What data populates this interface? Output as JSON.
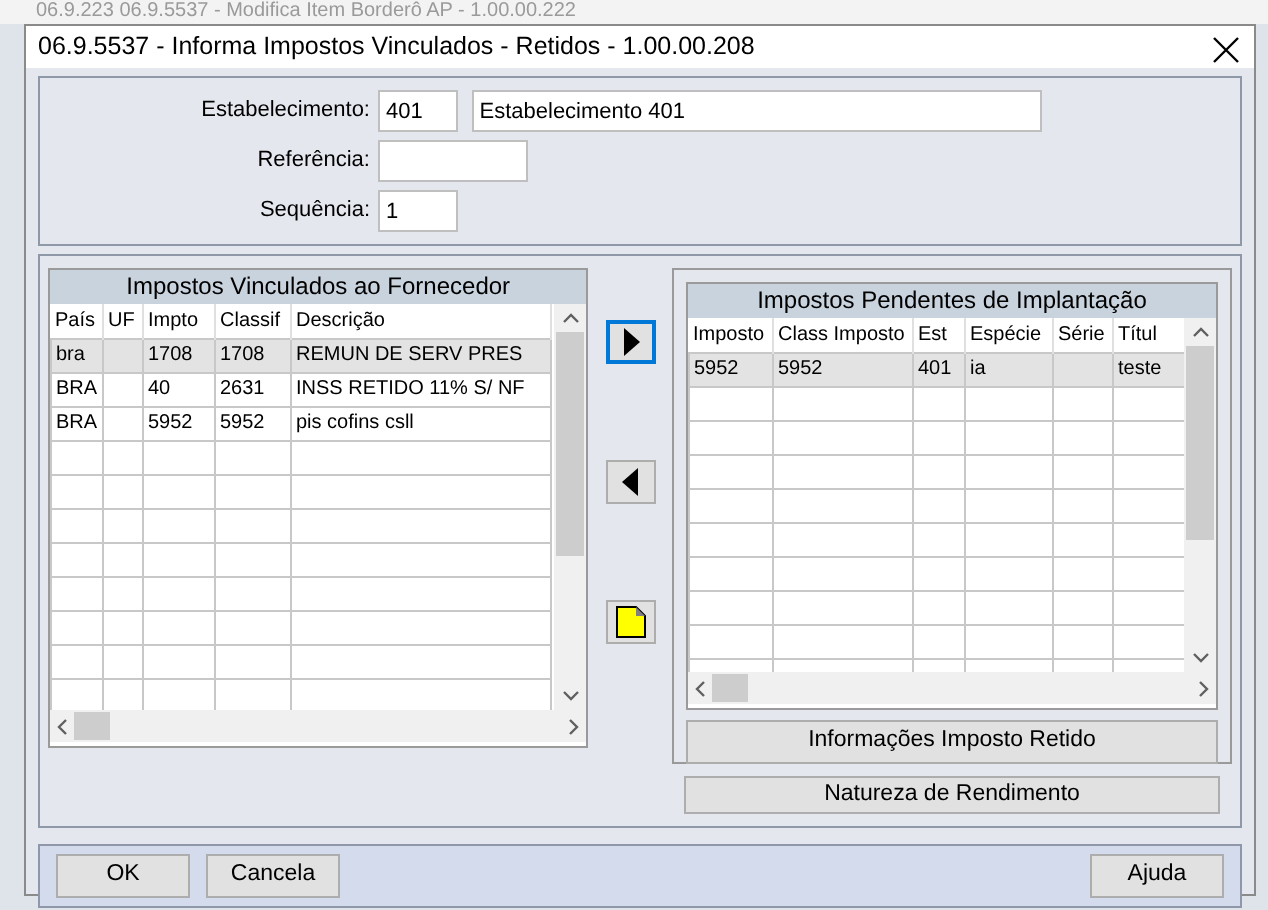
{
  "background_window": {
    "title": "06.9.223 06.9.5537 - Modifica Item Borderô AP - 1.00.00.222"
  },
  "window": {
    "title": "06.9.5537 - Informa Impostos Vinculados - Retidos - 1.00.00.208"
  },
  "header_fields": [
    {
      "label": "Estabelecimento:",
      "value": "401",
      "description": "Estabelecimento 401"
    },
    {
      "label": "Referência:"
    },
    {
      "label": "Sequência:",
      "value": "1"
    }
  ],
  "left_table": {
    "title": "Impostos Vinculados ao Fornecedor",
    "columns": [
      "País",
      "UF",
      "Impto",
      "Classif",
      "Descrição"
    ],
    "rows": [
      {
        "cells": [
          "bra",
          "",
          "1708",
          "1708",
          "REMUN DE SERV PRES"
        ],
        "selected": true
      },
      {
        "cells": [
          "BRA",
          "",
          "40",
          "2631",
          "INSS RETIDO 11% S/ NF"
        ],
        "selected": false
      },
      {
        "cells": [
          "BRA",
          "",
          "5952",
          "5952",
          "pis cofins csll"
        ],
        "selected": false
      }
    ]
  },
  "transfer_buttons": [
    {
      "kind": "move-right",
      "focused": true
    },
    {
      "kind": "move-left",
      "focused": false
    },
    {
      "kind": "new",
      "focused": false
    }
  ],
  "right_table": {
    "title": "Impostos Pendentes de Implantação",
    "columns": [
      "Imposto",
      "Class Imposto",
      "Est",
      "Espécie",
      "Série",
      "Títul"
    ],
    "rows": [
      {
        "cells": [
          "5952",
          "5952",
          "401",
          "ia",
          "",
          "teste"
        ],
        "selected": true
      }
    ]
  },
  "right_panel_button": "Informações Imposto Retido",
  "natureza_button": "Natureza de Rendimento",
  "footer_left_buttons": [
    "OK",
    "Cancela"
  ],
  "footer_right_buttons": [
    "Ajuda"
  ]
}
